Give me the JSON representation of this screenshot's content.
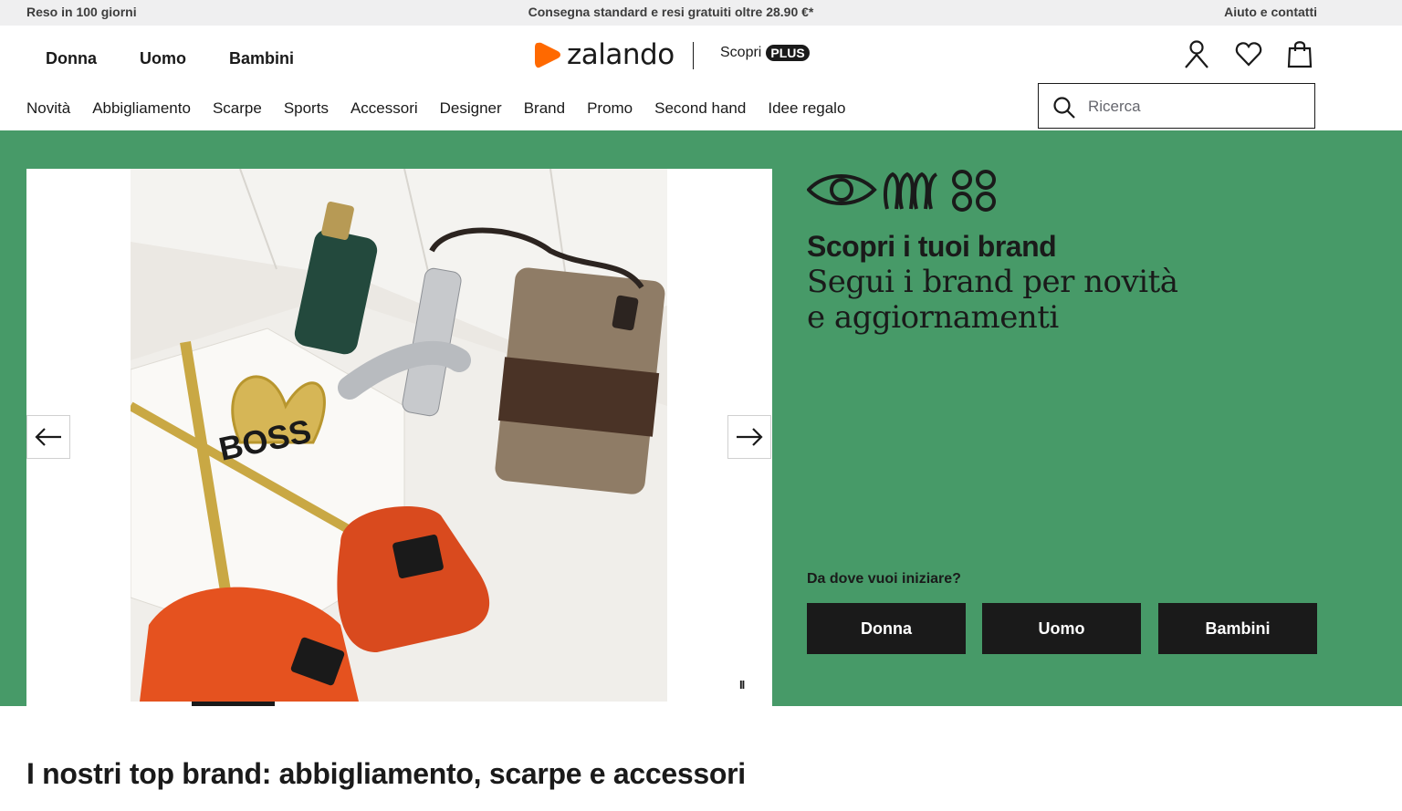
{
  "topbar": {
    "left": "Reso in 100 giorni",
    "center": "Consegna standard e resi gratuiti oltre 28.90 €*",
    "right": "Aiuto e contatti"
  },
  "gender_nav": [
    "Donna",
    "Uomo",
    "Bambini"
  ],
  "logo": {
    "word": "zalando",
    "color": "#ff6900"
  },
  "plus": {
    "label": "Scopri",
    "badge": "PLUS"
  },
  "header_icons": [
    "user-icon",
    "heart-icon",
    "bag-icon"
  ],
  "categories": [
    "Novità",
    "Abbigliamento",
    "Scarpe",
    "Sports",
    "Accessori",
    "Designer",
    "Brand",
    "Promo",
    "Second hand",
    "Idee regalo"
  ],
  "search": {
    "placeholder": "Ricerca",
    "value": ""
  },
  "hero": {
    "bg_color": "#479a68",
    "title": "Scopri i tuoi brand",
    "subtitle": "Segui i brand per novità e aggiornamenti",
    "question": "Da dove vuoi iniziare?",
    "buttons": [
      "Donna",
      "Uomo",
      "Bambini"
    ],
    "pause_label": "II",
    "carousel_progress": 0.47,
    "box_text": "BOSS"
  },
  "section": {
    "title": "I nostri top brand: abbigliamento, scarpe e accessori"
  }
}
